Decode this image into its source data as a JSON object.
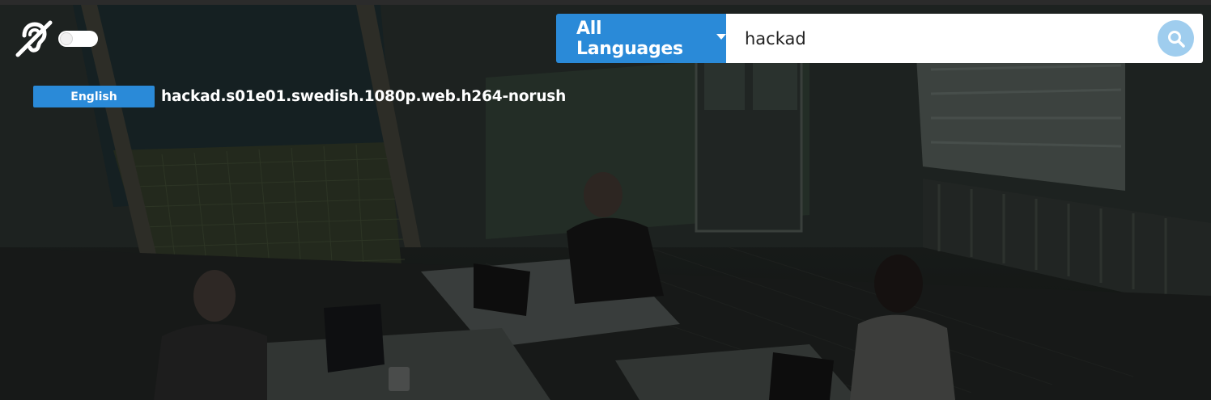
{
  "search": {
    "language_label": "All Languages",
    "query": "hackad"
  },
  "results": [
    {
      "language": "English",
      "title": "hackad.s01e01.swedish.1080p.web.h264-norush"
    }
  ],
  "icons": {
    "accessibility": "hearing-impaired-icon",
    "search": "search-icon",
    "dropdown": "chevron-down-icon"
  },
  "colors": {
    "accent": "#2a8ad8",
    "search_button": "#9fcdee",
    "text_on_dark": "#ffffff"
  }
}
